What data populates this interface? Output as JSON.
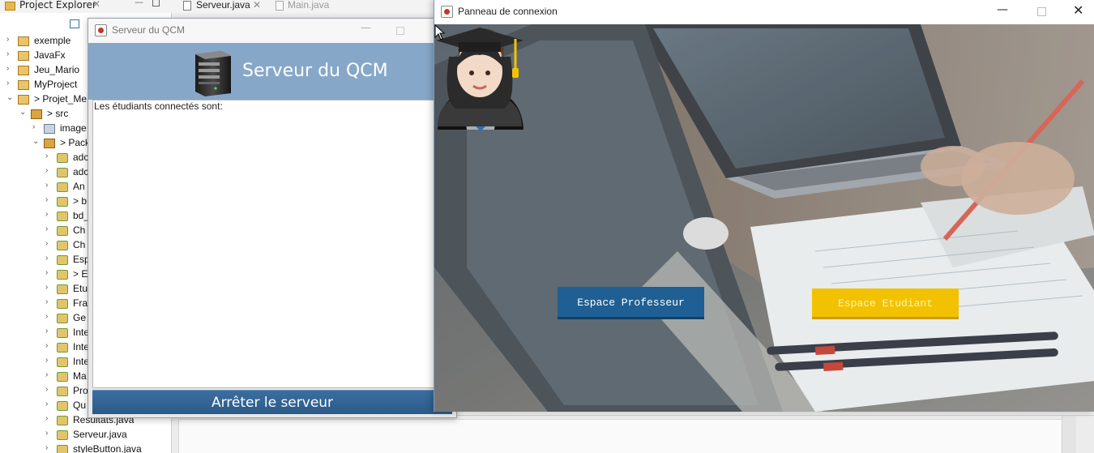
{
  "ide": {
    "explorer_tab": "Project Explorer",
    "editor_tabs": [
      "Serveur.java",
      "Main.java"
    ],
    "tree": [
      {
        "label": "exemple",
        "indent": 0,
        "chevron": "›",
        "icon": "project-icon"
      },
      {
        "label": "JavaFx",
        "indent": 0,
        "chevron": "›",
        "icon": "project-icon"
      },
      {
        "label": "Jeu_Mario",
        "indent": 0,
        "chevron": "›",
        "icon": "project-icon"
      },
      {
        "label": "MyProject",
        "indent": 0,
        "chevron": "›",
        "icon": "project-icon"
      },
      {
        "label": "> Projet_Me",
        "indent": 0,
        "chevron": "⌄",
        "icon": "project-icon"
      },
      {
        "label": "> src",
        "indent": 1,
        "chevron": "⌄",
        "icon": "package-icon"
      },
      {
        "label": "image",
        "indent": 2,
        "chevron": "›",
        "icon": "image-package-icon"
      },
      {
        "label": "> Pack",
        "indent": 2,
        "chevron": "⌄",
        "icon": "package-icon"
      },
      {
        "label": "adc",
        "indent": 3,
        "chevron": "›",
        "icon": "java-file-icon"
      },
      {
        "label": "adc",
        "indent": 3,
        "chevron": "›",
        "icon": "java-file-icon"
      },
      {
        "label": "An",
        "indent": 3,
        "chevron": "›",
        "icon": "java-file-icon"
      },
      {
        "label": "> b",
        "indent": 3,
        "chevron": "›",
        "icon": "java-file-icon"
      },
      {
        "label": "bd_",
        "indent": 3,
        "chevron": "›",
        "icon": "java-file-icon"
      },
      {
        "label": "Ch",
        "indent": 3,
        "chevron": "›",
        "icon": "java-file-icon"
      },
      {
        "label": "Ch",
        "indent": 3,
        "chevron": "›",
        "icon": "java-file-icon"
      },
      {
        "label": "Esp",
        "indent": 3,
        "chevron": "›",
        "icon": "java-file-icon"
      },
      {
        "label": "> E",
        "indent": 3,
        "chevron": "›",
        "icon": "java-file-icon"
      },
      {
        "label": "Etu",
        "indent": 3,
        "chevron": "›",
        "icon": "java-file-icon"
      },
      {
        "label": "Fra",
        "indent": 3,
        "chevron": "›",
        "icon": "java-file-icon"
      },
      {
        "label": "Ge",
        "indent": 3,
        "chevron": "›",
        "icon": "java-file-icon"
      },
      {
        "label": "Inte",
        "indent": 3,
        "chevron": "›",
        "icon": "java-file-icon"
      },
      {
        "label": "Inte",
        "indent": 3,
        "chevron": "›",
        "icon": "java-file-icon"
      },
      {
        "label": "Inte",
        "indent": 3,
        "chevron": "›",
        "icon": "java-file-icon"
      },
      {
        "label": "Ma",
        "indent": 3,
        "chevron": "›",
        "icon": "java-file-icon"
      },
      {
        "label": "Pro",
        "indent": 3,
        "chevron": "›",
        "icon": "java-file-icon"
      },
      {
        "label": "Qu",
        "indent": 3,
        "chevron": "›",
        "icon": "java-file-icon"
      },
      {
        "label": "Resultats.java",
        "indent": 3,
        "chevron": "›",
        "icon": "java-file-icon"
      },
      {
        "label": "Serveur.java",
        "indent": 3,
        "chevron": "›",
        "icon": "java-file-icon"
      },
      {
        "label": "styleButton.java",
        "indent": 3,
        "chevron": "›",
        "icon": "java-file-icon"
      }
    ]
  },
  "server_window": {
    "title": "Serveur du QCM",
    "heading": "Serveur du QCM",
    "connected_label": "Les étudiants connectés sont:",
    "stop_button": "Arrêter le serveur",
    "header_color": "#87a7c8",
    "button_color": "#2c5a88"
  },
  "login_window": {
    "title": "Panneau de connexion",
    "minimize_glyph": "—",
    "close_glyph": "✕",
    "professor_button": "Espace Professeur",
    "student_button": "Espace Etudiant",
    "professor_color": "#1f5f94",
    "student_color": "#f2c200",
    "professor_icon": "professor-avatar-icon",
    "student_icon": "graduate-student-avatar-icon"
  }
}
